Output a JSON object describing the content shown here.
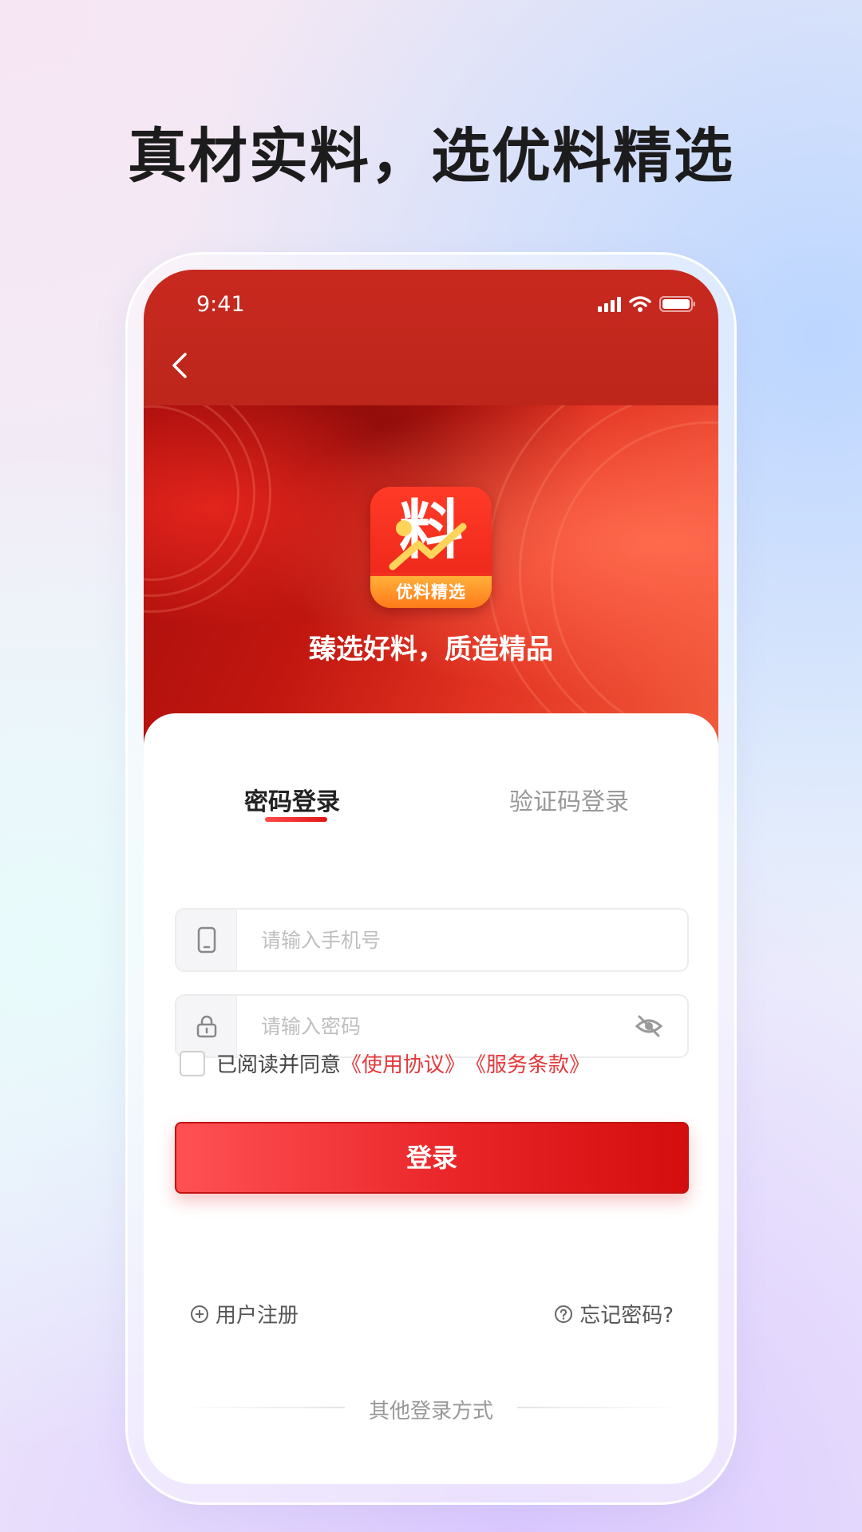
{
  "headline": "真材实料，选优料精选",
  "status_bar": {
    "time": "9:41"
  },
  "hero": {
    "logo_glyph": "料",
    "logo_label": "优料精选",
    "slogan": "臻选好料，质造精品"
  },
  "tabs": [
    {
      "label": "密码登录",
      "active": true
    },
    {
      "label": "验证码登录",
      "active": false
    }
  ],
  "form": {
    "phone_placeholder": "请输入手机号",
    "password_placeholder": "请输入密码"
  },
  "agreement": {
    "text": "已阅读并同意",
    "link1": "《使用协议》",
    "link2": "《服务条款》"
  },
  "login_button": "登录",
  "register_link": "用户注册",
  "forgot_link": "忘记密码?",
  "other_login": "其他登录方式",
  "colors": {
    "brand_red": "#c8291f",
    "button_red": "#e92528",
    "link_red": "#e5383b"
  }
}
